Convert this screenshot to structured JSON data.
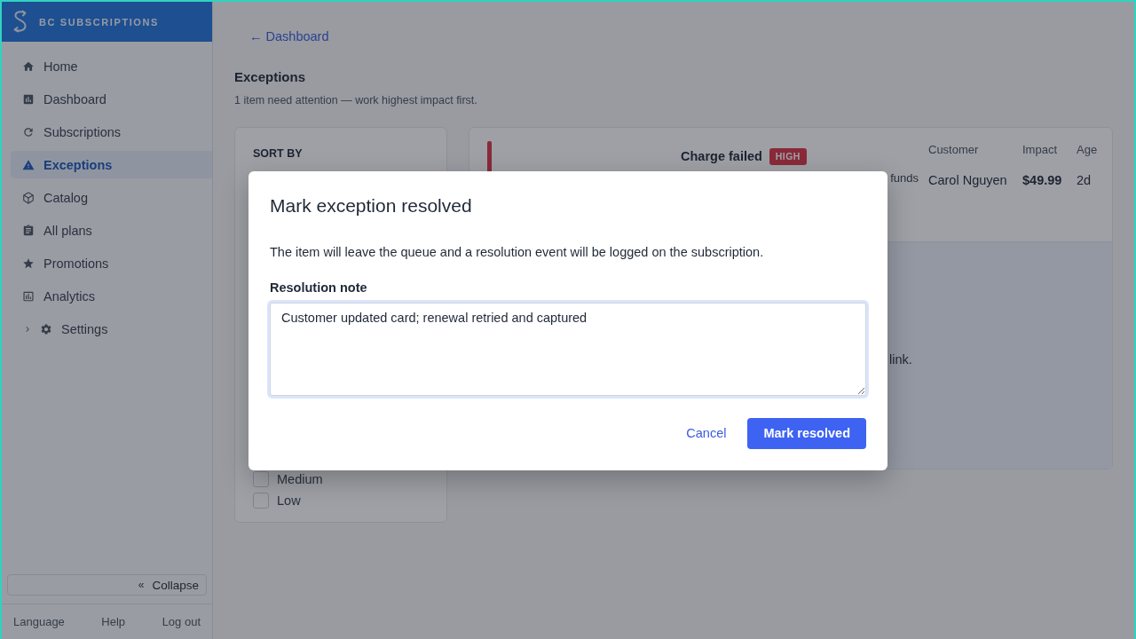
{
  "sidebar": {
    "brand": "BC SUBSCRIPTIONS",
    "items": [
      {
        "label": "Home",
        "kind": "link",
        "selected": false
      },
      {
        "label": "Dashboard",
        "kind": "link",
        "selected": false
      },
      {
        "label": "Subscriptions",
        "kind": "link",
        "selected": false
      },
      {
        "label": "Exceptions",
        "kind": "link",
        "selected": true
      },
      {
        "label": "Catalog",
        "kind": "link",
        "selected": false
      },
      {
        "label": "All plans",
        "kind": "link",
        "selected": false
      },
      {
        "label": "Promotions",
        "kind": "link",
        "selected": false
      },
      {
        "label": "Analytics",
        "kind": "link",
        "selected": false
      },
      {
        "label": "Settings",
        "kind": "group",
        "selected": false,
        "expanded": false
      }
    ],
    "collapse_button": {
      "glyph": "«",
      "label": "Collapse"
    },
    "footer_links": [
      "Language",
      "Help",
      "Log out"
    ]
  },
  "back_link": "← Dashboard",
  "page": {
    "title": "Exceptions",
    "subtitle": "1 item need attention — work highest impact first."
  },
  "filter_panel": {
    "heading": "SORT BY",
    "options": [
      {
        "label": "Medium",
        "checked": false
      },
      {
        "label": "Low",
        "checked": false
      }
    ]
  },
  "exceptions": [
    {
      "title": "Charge failed",
      "badge": "HIGH",
      "reason_fragment": "funds",
      "columns": [
        "Customer",
        "Impact",
        "Age"
      ],
      "cells": [
        "Carol Nguyen",
        "$49.99",
        "2d"
      ],
      "detail_fragment": "link."
    }
  ],
  "modal": {
    "title": "Mark exception resolved",
    "description": "The item will leave the queue and a resolution event will be logged on the subscription.",
    "field": {
      "label": "Resolution note",
      "value": "Customer updated card; renewal retried and captured",
      "focused": true
    },
    "buttons": [
      {
        "label": "Cancel",
        "kind": "link"
      },
      {
        "label": "Mark resolved",
        "kind": "primary"
      }
    ]
  }
}
